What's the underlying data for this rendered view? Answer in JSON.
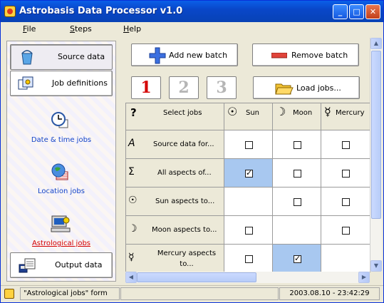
{
  "window": {
    "title": "Astrobasis Data Processor v1.0"
  },
  "menu": {
    "items": [
      "File",
      "Steps",
      "Help"
    ]
  },
  "sidebar": {
    "source_data": "Source data",
    "job_definitions": "Job definitions",
    "date_time_jobs": "Date & time jobs",
    "location_jobs": "Location jobs",
    "astrological_jobs": "Astrological jobs",
    "output_data": "Output data"
  },
  "toolbar": {
    "add_batch": "Add new batch",
    "remove_batch": "Remove batch",
    "load_jobs": "Load  jobs...",
    "batch_numbers": [
      "1",
      "2",
      "3"
    ],
    "active_batch": "1"
  },
  "grid": {
    "corner_label": "Select jobs",
    "columns": [
      {
        "label": "Sun",
        "symbol": "☉"
      },
      {
        "label": "Moon",
        "symbol": "☽"
      },
      {
        "label": "Mercury",
        "symbol": "☿"
      }
    ],
    "rows": [
      {
        "label": "Source data for...",
        "symbol": "A",
        "cells": [
          "unchecked",
          "unchecked",
          "unchecked"
        ]
      },
      {
        "label": "All aspects of...",
        "symbol": "Σ",
        "cells": [
          "checked-selected",
          "unchecked",
          "unchecked"
        ]
      },
      {
        "label": "Sun aspects to...",
        "symbol": "☉",
        "cells": [
          "none",
          "unchecked",
          "unchecked"
        ]
      },
      {
        "label": "Moon aspects to...",
        "symbol": "☽",
        "cells": [
          "unchecked",
          "none",
          "unchecked"
        ]
      },
      {
        "label": "Mercury aspects to...",
        "symbol": "☿",
        "cells": [
          "unchecked",
          "checked-selected",
          "none"
        ]
      }
    ],
    "selection_color": "#a8c8f0"
  },
  "status": {
    "form_label": "\"Astrological jobs\" form",
    "timestamp": "2003.08.10 - 23:42:29"
  },
  "colors": {
    "active_batch": "#d40000",
    "link": "#1545c7",
    "title_bar": "#0a5fe8"
  }
}
